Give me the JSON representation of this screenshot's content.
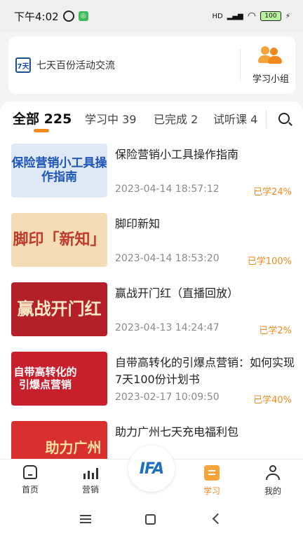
{
  "status_bar": {
    "time": "下午4:02",
    "signal": "HD",
    "battery": "100"
  },
  "header": {
    "logo_text": "7天",
    "group_name": "七天百份活动交流",
    "study_group_label": "学习小组"
  },
  "tabs": [
    {
      "label": "全部",
      "count": "225",
      "active": true
    },
    {
      "label": "学习中",
      "count": "39"
    },
    {
      "label": "已完成",
      "count": "2"
    },
    {
      "label": "试听课",
      "count": "4"
    }
  ],
  "courses": [
    {
      "thumb_text": "保险营销小工具操作指南",
      "thumb_bg": "#dfe8f5",
      "thumb_color": "#1e56b8",
      "title": "保险营销小工具操作指南",
      "date": "2023-04-14 18:57:12",
      "progress": "已学24%"
    },
    {
      "thumb_text": "脚印「新知」",
      "thumb_bg": "#f4dcb6",
      "thumb_color": "#c0392b",
      "title": "脚印新知",
      "date": "2023-04-14 18:53:20",
      "progress": "已学100%"
    },
    {
      "thumb_text": "赢战开门红",
      "thumb_bg": "#b3202a",
      "thumb_color": "#ffe9c4",
      "title": "赢战开门红（直播回放）",
      "date": "2023-04-13 14:24:47",
      "progress": "已学2%"
    },
    {
      "thumb_text": "自带高转化的引爆点营销",
      "thumb_bg": "#c81f2d",
      "thumb_color": "#ffffff",
      "title": "自带高转化的引爆点营销：如何实现7天100份计划书",
      "date": "2023-02-17 10:09:50",
      "progress": "已学40%"
    },
    {
      "thumb_text": "助力广州",
      "thumb_bg": "#d9302f",
      "thumb_color": "#ffe2a0",
      "title": "助力广州七天充电福利包",
      "date": "",
      "progress": ""
    }
  ],
  "bottom_nav": {
    "home": "首页",
    "marketing": "营销",
    "center_logo": "IFA",
    "study": "学习",
    "me": "我的"
  },
  "colors": {
    "accent": "#f08a1e"
  }
}
